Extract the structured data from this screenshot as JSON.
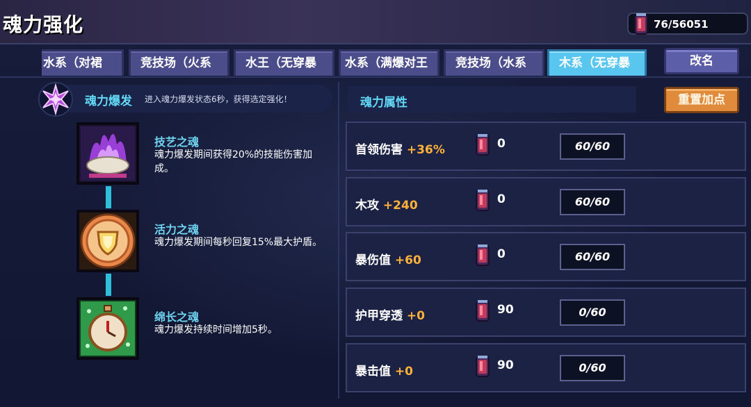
{
  "header": {
    "title": "魂力强化",
    "currency_value": "76/56051"
  },
  "tabs": [
    {
      "label": "水系（对裙",
      "active": false
    },
    {
      "label": "竞技场（火系",
      "active": false
    },
    {
      "label": "水王（无穿暴",
      "active": false
    },
    {
      "label": "水系（满爆对王",
      "active": false
    },
    {
      "label": "竞技场（水系",
      "active": false
    },
    {
      "label": "木系（无穿暴",
      "active": true
    }
  ],
  "buttons": {
    "rename": "改名",
    "reset": "重置加点"
  },
  "burst": {
    "title": "魂力爆发",
    "description": "进入魂力爆发状态6秒，获得选定强化！"
  },
  "souls": [
    {
      "name": "技艺之魂",
      "description": "魂力爆发期间获得20%的技能伤害加成。",
      "icon": "purple-flame-shell-icon"
    },
    {
      "name": "活力之魂",
      "description": "魂力爆发期间每秒回复15%最大护盾。",
      "icon": "shield-medal-icon"
    },
    {
      "name": "绵长之魂",
      "description": "魂力爆发持续时间增加5秒。",
      "icon": "stopwatch-icon"
    }
  ],
  "attributes": {
    "title": "魂力属性",
    "rows": [
      {
        "name": "首领伤害",
        "bonus": "+36%",
        "cost": "0",
        "level": "60/60"
      },
      {
        "name": "木攻",
        "bonus": "+240",
        "cost": "0",
        "level": "60/60"
      },
      {
        "name": "暴伤值",
        "bonus": "+60",
        "cost": "0",
        "level": "60/60"
      },
      {
        "name": "护甲穿透",
        "bonus": "+0",
        "cost": "90",
        "level": "0/60"
      },
      {
        "name": "暴击值",
        "bonus": "+0",
        "cost": "90",
        "level": "0/60"
      }
    ]
  },
  "colors": {
    "accent": "#62d8f7",
    "bonus": "#ffb13a",
    "reset_button": "#e08a3c",
    "active_tab": "#58c6ee"
  }
}
